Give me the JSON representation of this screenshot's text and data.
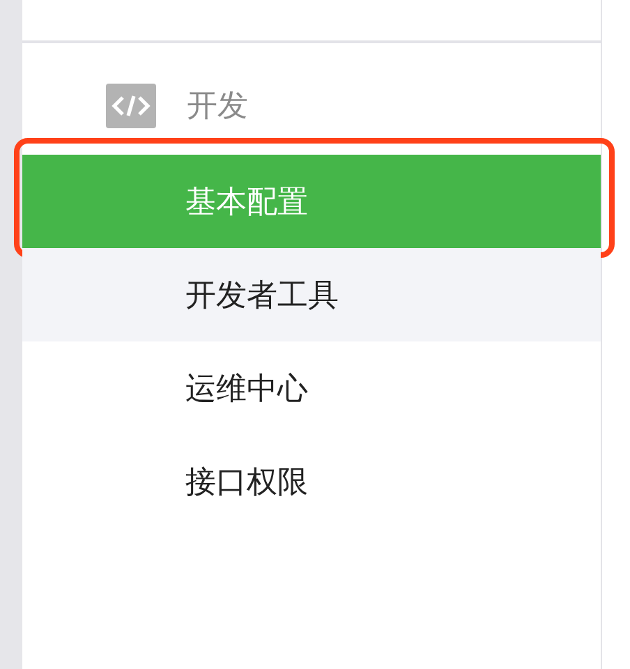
{
  "sidebar": {
    "section": {
      "label": "开发"
    },
    "items": [
      {
        "label": "基本配置",
        "selected": true,
        "hovered": false,
        "highlighted": true
      },
      {
        "label": "开发者工具",
        "selected": false,
        "hovered": true,
        "highlighted": false
      },
      {
        "label": "运维中心",
        "selected": false,
        "hovered": false,
        "highlighted": false
      },
      {
        "label": "接口权限",
        "selected": false,
        "hovered": false,
        "highlighted": false
      }
    ]
  }
}
